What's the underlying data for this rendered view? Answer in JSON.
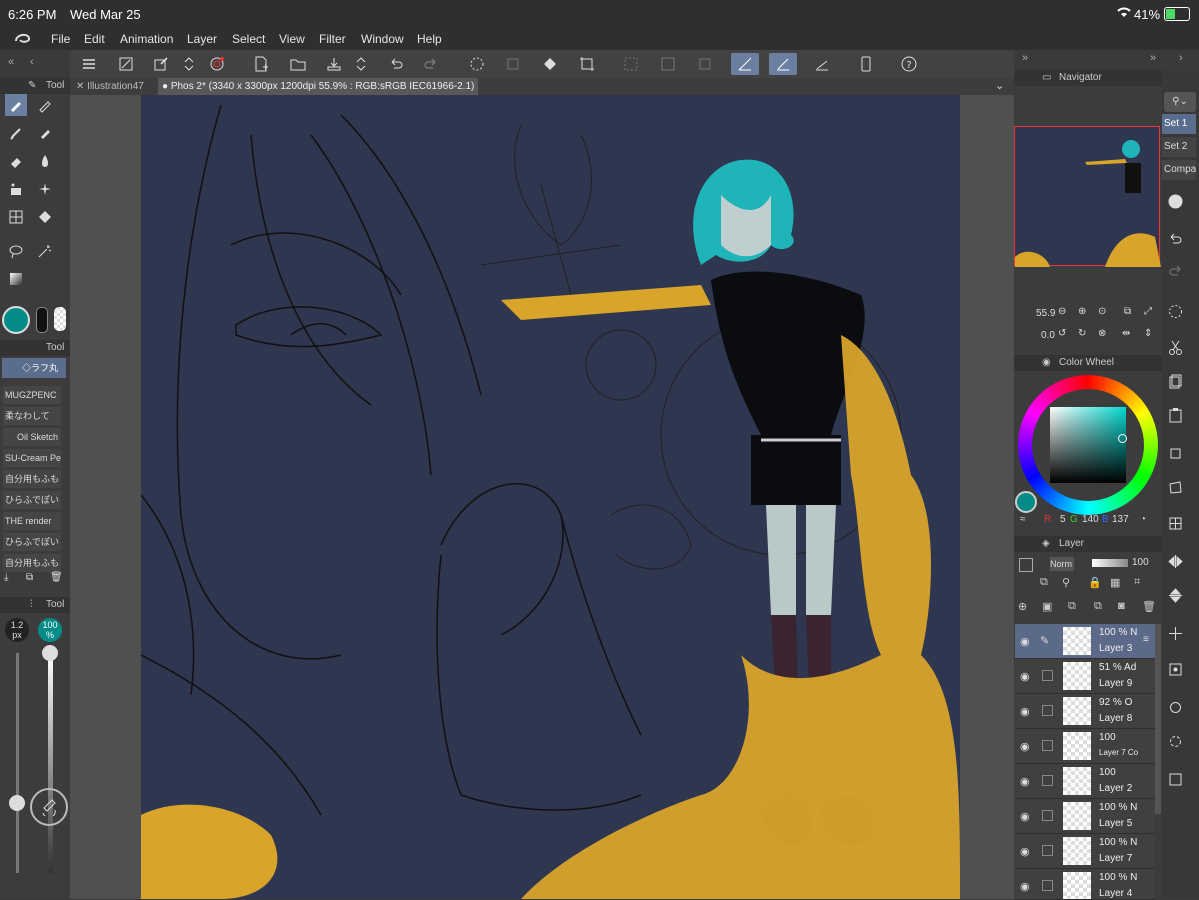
{
  "status": {
    "time": "6:26 PM",
    "date": "Wed Mar 25",
    "battery": "41%"
  },
  "menu": [
    "File",
    "Edit",
    "Animation",
    "Layer",
    "Select",
    "View",
    "Filter",
    "Window",
    "Help"
  ],
  "tabs": [
    {
      "label": "Illustration47"
    },
    {
      "label": "Phos 2* (3340 x 3300px 1200dpi 55.9% : RGB:sRGB IEC61966-2.1)"
    }
  ],
  "left": {
    "tool_panel_title": "Tool",
    "sub_tool_title": "Tool",
    "tool_property_title": "Tool",
    "active_brush": "◇ラフ丸",
    "brushes": [
      "MUGZPENC",
      "柔なわして",
      "Oil Sketch",
      "SU-Cream Pe",
      "自分用もふも",
      "ひらふでぽい",
      "THE render",
      "ひらふでぽい",
      "自分用もふも"
    ],
    "brush_size": "1.2",
    "brush_size_unit": "px",
    "opacity": "100",
    "opacity_unit": "%"
  },
  "navigator": {
    "title": "Navigator",
    "zoom": "55.9",
    "rotation": "0.0"
  },
  "color_wheel": {
    "title": "Color Wheel",
    "r_label": "R",
    "r": "5",
    "g_label": "G",
    "g": "140",
    "b_label": "B",
    "b": "137",
    "current_color": "#058c89"
  },
  "layer_panel": {
    "title": "Layer",
    "blend": "Norm",
    "opacity": "100",
    "layers": [
      {
        "opacity": "100 % N",
        "name": "Layer 3"
      },
      {
        "opacity": "51 % Ad",
        "name": "Layer 9"
      },
      {
        "opacity": "92 % O",
        "name": "Layer 8"
      },
      {
        "opacity": "100",
        "name": "Layer 7 Co"
      },
      {
        "opacity": "100",
        "name": "Layer 2"
      },
      {
        "opacity": "100 % N",
        "name": "Layer 5"
      },
      {
        "opacity": "100 % N",
        "name": "Layer 7"
      },
      {
        "opacity": "100 % N",
        "name": "Layer 4"
      }
    ]
  },
  "sets": [
    "Set 1",
    "Set 2",
    "Compa"
  ]
}
